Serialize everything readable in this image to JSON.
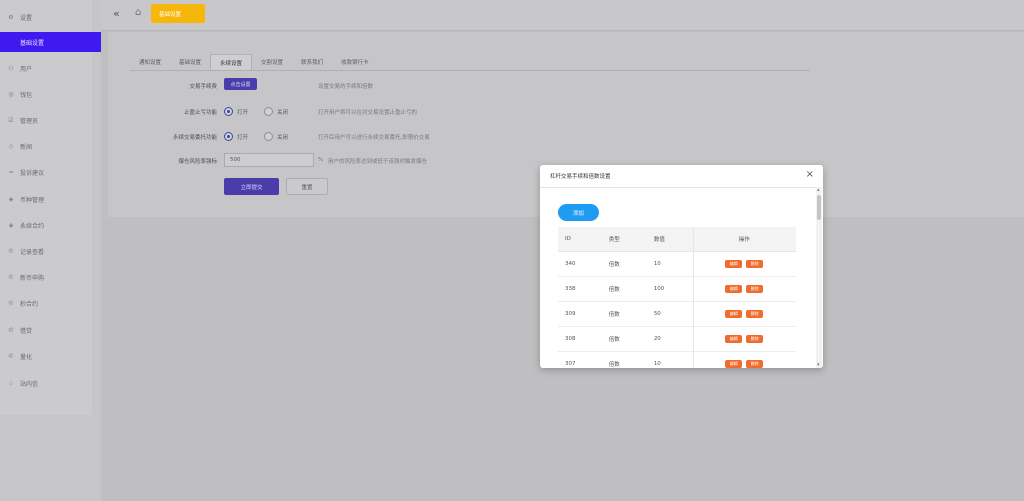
{
  "sidebar": {
    "items": [
      {
        "label": "设置",
        "icon": "gear-icon"
      },
      {
        "label": "基础设置",
        "icon": ""
      },
      {
        "label": "用户",
        "icon": "user-icon"
      },
      {
        "label": "钱包",
        "icon": "wallet-icon"
      },
      {
        "label": "管理员",
        "icon": "admin-icon"
      },
      {
        "label": "新闻",
        "icon": "tag-icon"
      },
      {
        "label": "投诉建议",
        "icon": "feedback-icon"
      },
      {
        "label": "币种管理",
        "icon": "diamond-icon"
      },
      {
        "label": "永续合约",
        "icon": "diamond-icon"
      },
      {
        "label": "记录查看",
        "icon": "record-icon"
      },
      {
        "label": "新币申购",
        "icon": "record-icon"
      },
      {
        "label": "秒合约",
        "icon": "record-icon"
      },
      {
        "label": "借贷",
        "icon": "record-icon"
      },
      {
        "label": "量化",
        "icon": "record-icon"
      },
      {
        "label": "站内信",
        "icon": "bell-icon"
      }
    ]
  },
  "topbar": {
    "tag_label": "基础设置"
  },
  "tabs": [
    "通知设置",
    "基础设置",
    "永续设置",
    "交割设置",
    "联系我们",
    "收款银行卡"
  ],
  "form": {
    "fee_label": "交易手续费",
    "fee_button": "点击设置",
    "fee_hint": "设置交易的手续和倍数",
    "stop_label": "止盈止亏功能",
    "stop_on": "打开",
    "stop_off": "关闭",
    "stop_hint": "打开用户将可以在对交易设置止盈止亏的",
    "perp_label": "永续交易委托功能",
    "perp_on": "打开",
    "perp_off": "关闭",
    "perp_hint": "打开后用户可以进行永续交易委托,即限价交易",
    "risk_label": "爆仓风险率强标",
    "risk_value": "500",
    "risk_unit": "%",
    "risk_hint": "用户的风险率达到或低于该强时触发爆仓",
    "submit": "立即提交",
    "reset": "重置"
  },
  "modal": {
    "title": "杠杆交易手续和倍数设置",
    "add_button": "添加",
    "headers": {
      "id": "ID",
      "type": "类型",
      "qty": "数值",
      "op": "操作"
    },
    "edit_label": "编辑",
    "delete_label": "删除",
    "rows": [
      {
        "id": "340",
        "type": "倍数",
        "qty": "10"
      },
      {
        "id": "338",
        "type": "倍数",
        "qty": "100"
      },
      {
        "id": "309",
        "type": "倍数",
        "qty": "50"
      },
      {
        "id": "308",
        "type": "倍数",
        "qty": "20"
      },
      {
        "id": "307",
        "type": "倍数",
        "qty": "10"
      }
    ]
  }
}
